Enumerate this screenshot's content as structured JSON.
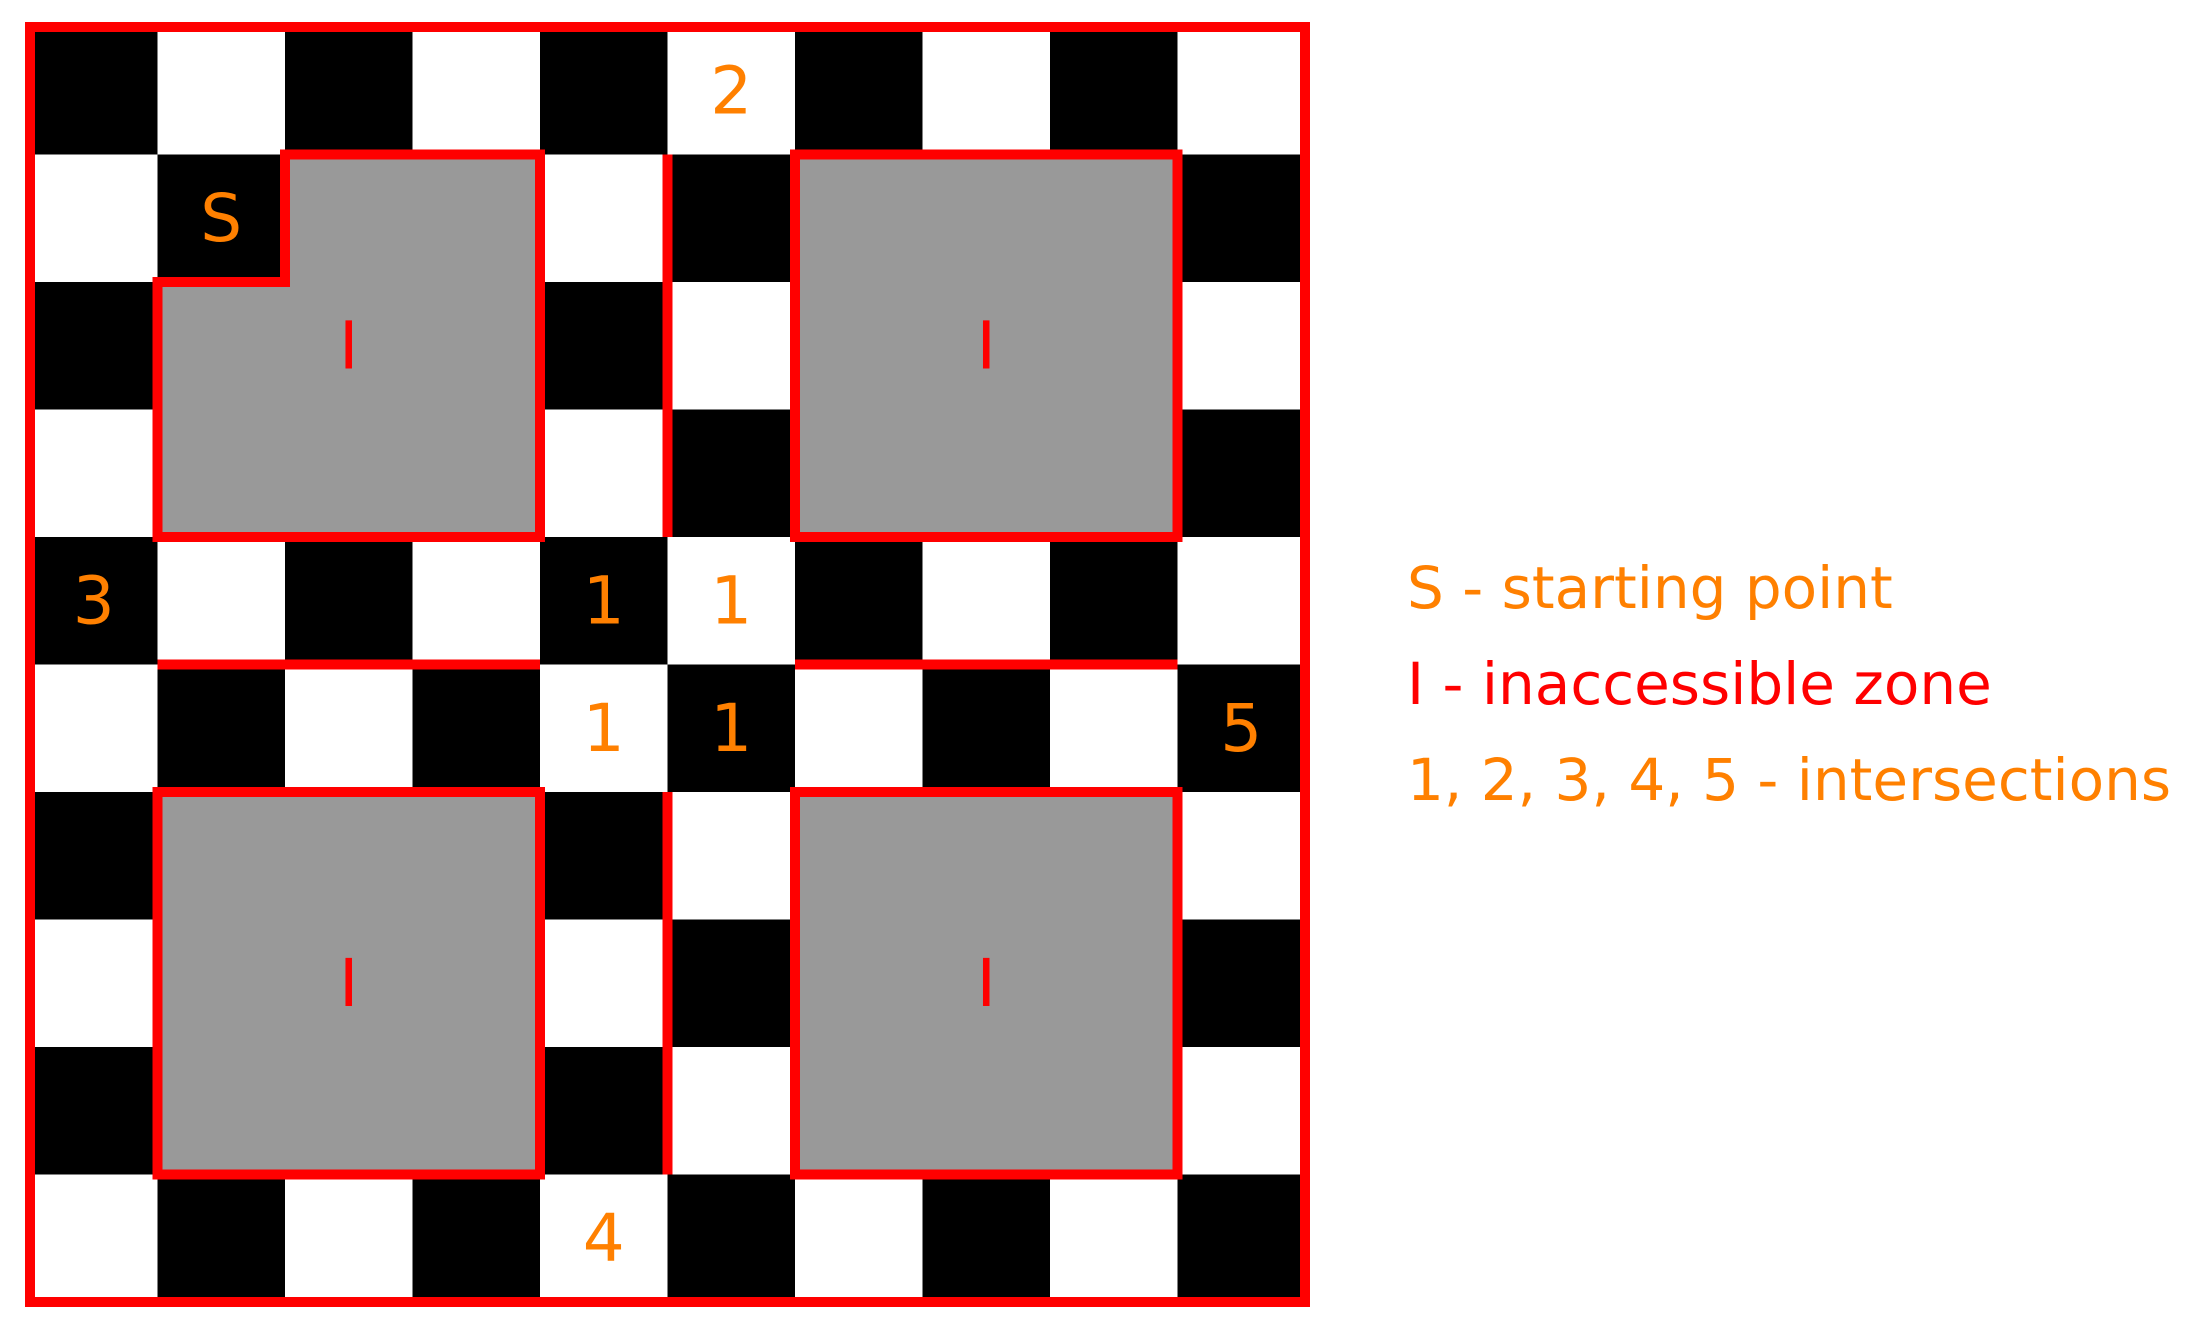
{
  "board": {
    "rows": 10,
    "cols": 10,
    "colors": {
      "dark_square": "#000000",
      "light_square": "#ffffff",
      "inaccessible_fill": "#999999",
      "wall": "#ff0000",
      "marker_orange": "#ff8000",
      "marker_red": "#ff0000"
    },
    "first_square": "dark",
    "cell_labels": [
      {
        "row": 0,
        "col": 5,
        "text": "2",
        "kind": "intersection"
      },
      {
        "row": 1,
        "col": 1,
        "text": "S",
        "kind": "start"
      },
      {
        "row": 4,
        "col": 0,
        "text": "3",
        "kind": "intersection"
      },
      {
        "row": 4,
        "col": 4,
        "text": "1",
        "kind": "intersection"
      },
      {
        "row": 4,
        "col": 5,
        "text": "1",
        "kind": "intersection"
      },
      {
        "row": 5,
        "col": 4,
        "text": "1",
        "kind": "intersection"
      },
      {
        "row": 5,
        "col": 5,
        "text": "1",
        "kind": "intersection"
      },
      {
        "row": 5,
        "col": 9,
        "text": "5",
        "kind": "intersection"
      },
      {
        "row": 9,
        "col": 4,
        "text": "4",
        "kind": "intersection"
      }
    ],
    "zones": [
      {
        "name": "top-left",
        "label": "I",
        "label_cell": [
          2,
          2
        ],
        "outline": [
          [
            1,
            2
          ],
          [
            1,
            4
          ],
          [
            4,
            4
          ],
          [
            4,
            1
          ],
          [
            2,
            1
          ],
          [
            2,
            2
          ]
        ]
      },
      {
        "name": "top-right",
        "label": "I",
        "label_cell": [
          2,
          7
        ],
        "outline": [
          [
            1,
            6
          ],
          [
            1,
            9
          ],
          [
            4,
            9
          ],
          [
            4,
            6
          ]
        ]
      },
      {
        "name": "bottom-left",
        "label": "I",
        "label_cell": [
          7,
          2
        ],
        "outline": [
          [
            6,
            1
          ],
          [
            6,
            4
          ],
          [
            9,
            4
          ],
          [
            9,
            1
          ]
        ]
      },
      {
        "name": "bottom-right",
        "label": "I",
        "label_cell": [
          7,
          7
        ],
        "outline": [
          [
            6,
            6
          ],
          [
            6,
            9
          ],
          [
            9,
            9
          ],
          [
            9,
            6
          ]
        ]
      }
    ],
    "walls": [
      {
        "name": "center-top-wall",
        "from": [
          1,
          5
        ],
        "to": [
          4,
          5
        ]
      },
      {
        "name": "center-bottom-wall",
        "from": [
          6,
          5
        ],
        "to": [
          9,
          5
        ]
      },
      {
        "name": "middle-left-wall",
        "from": [
          5,
          1
        ],
        "to": [
          5,
          4
        ]
      },
      {
        "name": "middle-right-wall",
        "from": [
          5,
          6
        ],
        "to": [
          5,
          9
        ]
      }
    ]
  },
  "legend": {
    "items": [
      {
        "text": "S - starting point",
        "color": "#ff8000"
      },
      {
        "text": "I - inaccessible zone",
        "color": "#ff0000"
      },
      {
        "text": "1, 2, 3, 4, 5 - intersections",
        "color": "#ff8000"
      }
    ]
  }
}
